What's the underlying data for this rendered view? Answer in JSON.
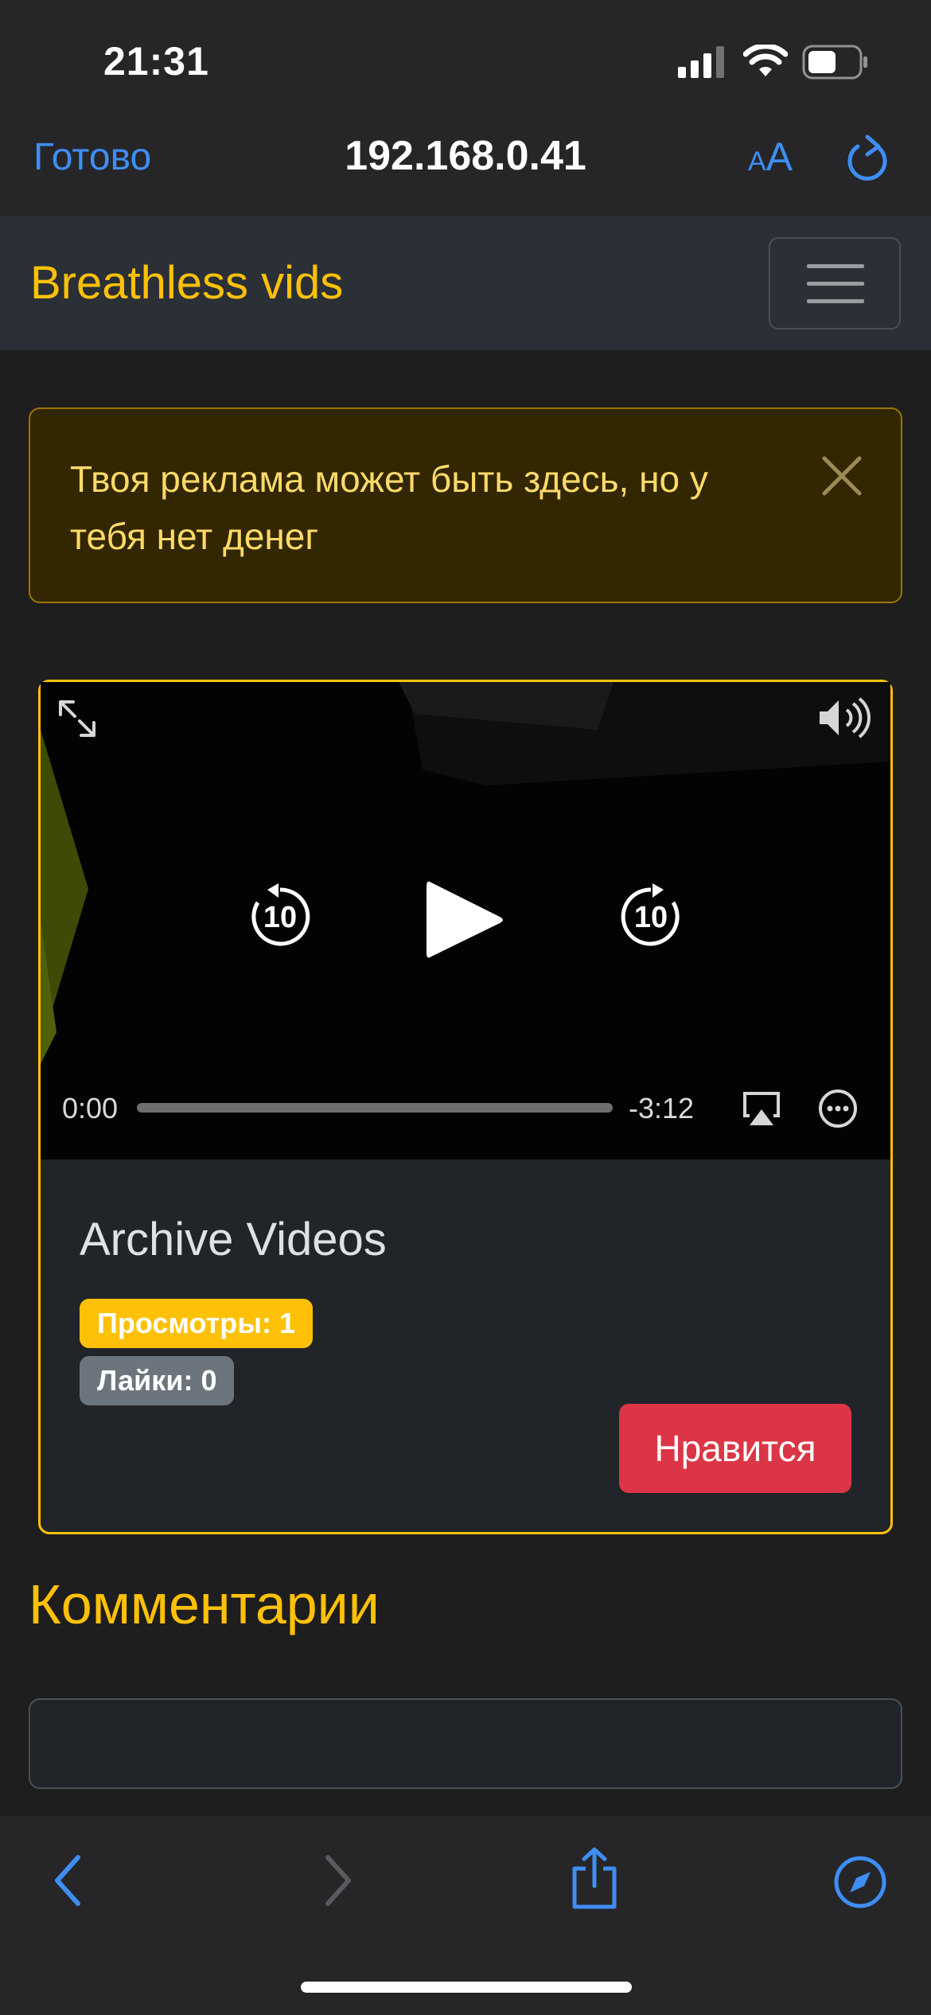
{
  "status_bar": {
    "time": "21:31"
  },
  "safari": {
    "done_label": "Готово",
    "url": "192.168.0.41",
    "text_size_label_small": "A",
    "text_size_label_large": "A"
  },
  "navbar": {
    "brand": "Breathless vids"
  },
  "alert": {
    "text": "Твоя реклама может быть здесь, но у тебя нет денег"
  },
  "player": {
    "current_time": "0:00",
    "remaining_time": "-3:12",
    "skip_back_label": "10",
    "skip_forward_label": "10",
    "progress": 0
  },
  "video": {
    "title": "Archive Videos",
    "views_label": "Просмотры: 1",
    "likes_label": "Лайки: 0",
    "like_button": "Нравится"
  },
  "comments": {
    "heading": "Комментарии"
  },
  "colors": {
    "accent": "#ffc107",
    "danger": "#dc3545",
    "ios_blue": "#3f8ef5",
    "secondary": "#6c757d"
  }
}
